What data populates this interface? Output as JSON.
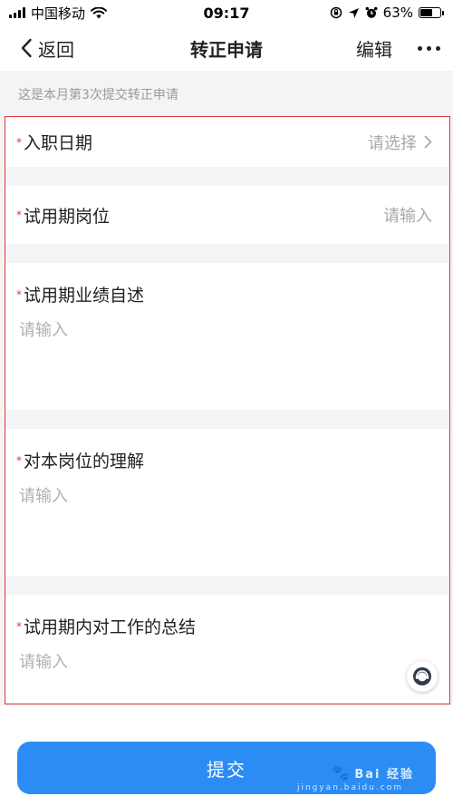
{
  "status_bar": {
    "carrier": "中国移动",
    "time": "09:17",
    "battery_percent": "63%",
    "battery_level": 0.63
  },
  "nav": {
    "back_label": "返回",
    "title": "转正申请",
    "edit_label": "编辑"
  },
  "hint": "这是本月第3次提交转正申请",
  "form": {
    "hire_date": {
      "label": "入职日期",
      "value": "请选择",
      "required": "*"
    },
    "probation_position": {
      "label": "试用期岗位",
      "placeholder": "请输入",
      "required": "*"
    },
    "performance_self_review": {
      "label": "试用期业绩自述",
      "placeholder": "请输入",
      "required": "*"
    },
    "position_understanding": {
      "label": "对本岗位的理解",
      "placeholder": "请输入",
      "required": "*"
    },
    "work_summary": {
      "label": "试用期内对工作的总结",
      "placeholder": "请输入",
      "required": "*"
    }
  },
  "submit_label": "提交",
  "watermark": {
    "brand": "Bai 经验",
    "sub": "jingyan.baidu.com"
  },
  "colors": {
    "accent": "#2b8cf4",
    "required": "#e0383a",
    "highlight_border": "#e0383a"
  }
}
